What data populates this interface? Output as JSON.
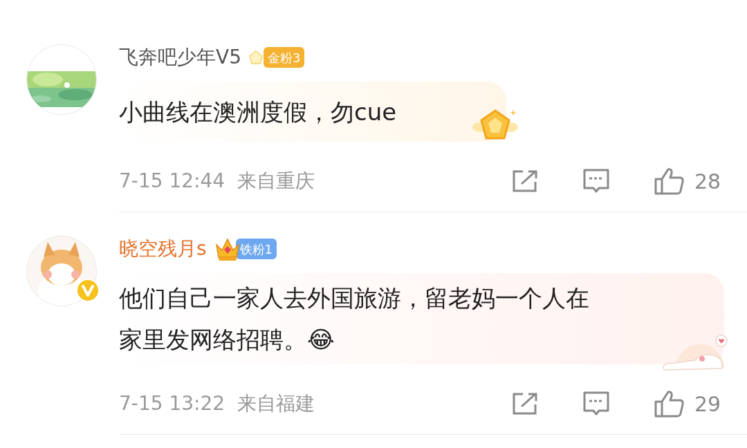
{
  "comments": [
    {
      "author": "飞奔吧少年V5",
      "vip": false,
      "verified": false,
      "badge": {
        "label": "金粉3",
        "kind": "crystal",
        "color": "#f5b232"
      },
      "text_lines": [
        "小曲线在澳洲度假，勿cue"
      ],
      "decoration": {
        "kind": "medal"
      },
      "time": "7-15 12:44",
      "location": "来自重庆",
      "likes": "28"
    },
    {
      "author": "晓空残月s",
      "vip": true,
      "verified": true,
      "badge": {
        "label": "铁粉1",
        "kind": "crown",
        "color": "#6ea8f0"
      },
      "text_lines": [
        "他们自己一家人去外国旅游，留老妈一个人在",
        "家里发网络招聘。😂"
      ],
      "decoration": {
        "kind": "cat"
      },
      "time": "7-15 13:22",
      "location": "来自福建",
      "likes": "29"
    }
  ]
}
